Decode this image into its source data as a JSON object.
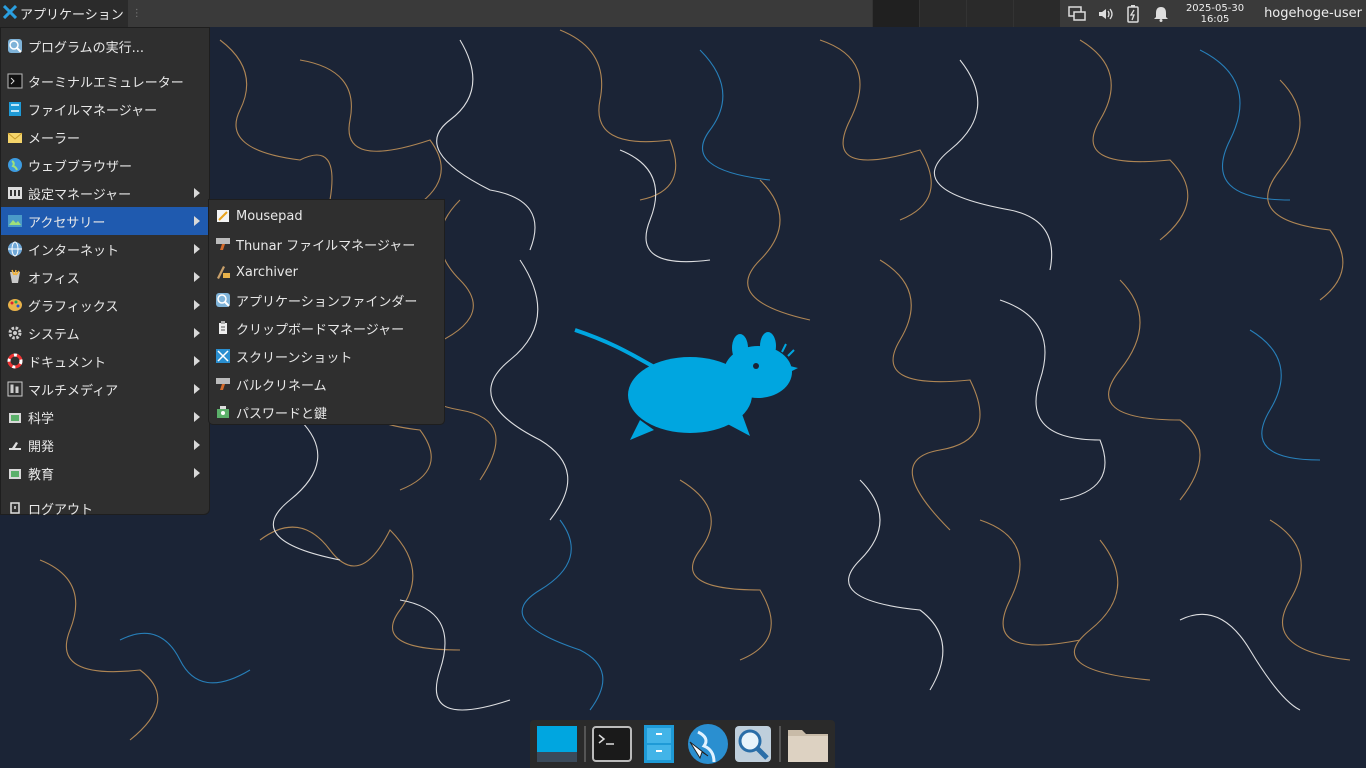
{
  "panel": {
    "app_menu_label": "アプリケーション",
    "clock_date": "2025-05-30",
    "clock_time": "16:05",
    "username": "hogehoge-user"
  },
  "menu": {
    "items": [
      {
        "label": "プログラムの実行...",
        "icon": "run-icon"
      },
      {
        "label": "ターミナルエミュレーター",
        "icon": "terminal-icon"
      },
      {
        "label": "ファイルマネージャー",
        "icon": "file-manager-icon"
      },
      {
        "label": "メーラー",
        "icon": "mail-icon"
      },
      {
        "label": "ウェブブラウザー",
        "icon": "browser-icon"
      },
      {
        "label": "設定マネージャー",
        "icon": "settings-icon"
      },
      {
        "label": "アクセサリー",
        "icon": "accessories-icon"
      },
      {
        "label": "インターネット",
        "icon": "internet-icon"
      },
      {
        "label": "オフィス",
        "icon": "office-icon"
      },
      {
        "label": "グラフィックス",
        "icon": "graphics-icon"
      },
      {
        "label": "システム",
        "icon": "system-icon"
      },
      {
        "label": "ドキュメント",
        "icon": "help-icon"
      },
      {
        "label": "マルチメディア",
        "icon": "multimedia-icon"
      },
      {
        "label": "科学",
        "icon": "science-icon"
      },
      {
        "label": "開発",
        "icon": "development-icon"
      },
      {
        "label": "教育",
        "icon": "education-icon"
      },
      {
        "label": "ログアウト",
        "icon": "logout-icon"
      }
    ]
  },
  "submenu": {
    "items": [
      {
        "label": "Mousepad",
        "icon": "mousepad-icon"
      },
      {
        "label": "Thunar ファイルマネージャー",
        "icon": "thunar-icon"
      },
      {
        "label": "Xarchiver",
        "icon": "archiver-icon"
      },
      {
        "label": "アプリケーションファインダー",
        "icon": "app-finder-icon"
      },
      {
        "label": "クリップボードマネージャー",
        "icon": "clipboard-icon"
      },
      {
        "label": "スクリーンショット",
        "icon": "screenshot-icon"
      },
      {
        "label": "バルクリネーム",
        "icon": "bulk-rename-icon"
      },
      {
        "label": "パスワードと鍵",
        "icon": "password-keys-icon"
      }
    ]
  },
  "colors": {
    "accent": "#1f5aaf",
    "menu_bg": "#2f2f2f",
    "xfce_blue": "#00a6e0",
    "wallpaper_bg": "#1b2436"
  }
}
